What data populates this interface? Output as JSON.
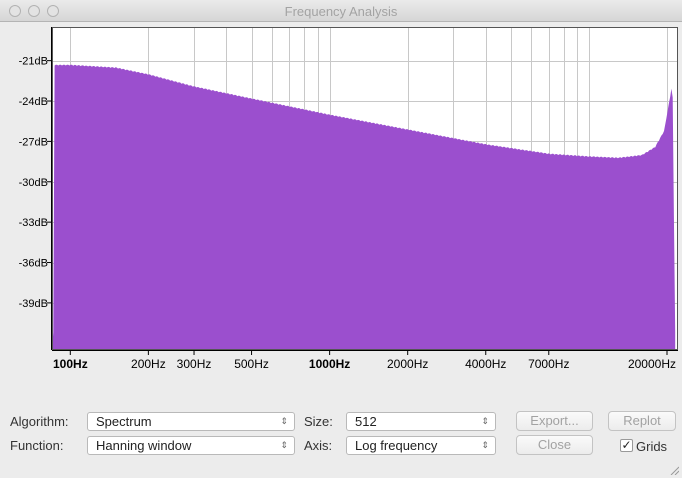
{
  "window": {
    "title": "Frequency Analysis"
  },
  "chart_data": {
    "type": "area",
    "title": "",
    "xlabel": "",
    "ylabel": "",
    "x_scale": "log",
    "xlim": [
      85,
      22050
    ],
    "ylim": [
      -42.5,
      -18.5
    ],
    "grid": true,
    "fill_color": "#9b4fce",
    "x_ticks": [
      {
        "value": 100,
        "label": "100Hz",
        "bold": true
      },
      {
        "value": 200,
        "label": "200Hz",
        "bold": false
      },
      {
        "value": 300,
        "label": "300Hz",
        "bold": false
      },
      {
        "value": 500,
        "label": "500Hz",
        "bold": false
      },
      {
        "value": 1000,
        "label": "1000Hz",
        "bold": true
      },
      {
        "value": 2000,
        "label": "2000Hz",
        "bold": false
      },
      {
        "value": 4000,
        "label": "4000Hz",
        "bold": false
      },
      {
        "value": 7000,
        "label": "7000Hz",
        "bold": false
      },
      {
        "value": 20000,
        "label": "20000Hz",
        "bold": false
      }
    ],
    "y_ticks": [
      {
        "value": -21,
        "label": "-21dB"
      },
      {
        "value": -24,
        "label": "-24dB"
      },
      {
        "value": -27,
        "label": "-27dB"
      },
      {
        "value": -30,
        "label": "-30dB"
      },
      {
        "value": -33,
        "label": "-33dB"
      },
      {
        "value": -36,
        "label": "-36dB"
      },
      {
        "value": -39,
        "label": "-39dB"
      }
    ],
    "x": [
      86,
      100,
      150,
      200,
      300,
      500,
      1000,
      2000,
      4000,
      7000,
      10000,
      13000,
      16000,
      18000,
      19500,
      20500,
      21000,
      21500
    ],
    "y": [
      -21.3,
      -21.3,
      -21.5,
      -22.0,
      -22.9,
      -23.8,
      -25.0,
      -26.1,
      -27.2,
      -27.9,
      -28.1,
      -28.2,
      -28.0,
      -27.4,
      -26.2,
      -23.8,
      -22.6,
      -41.2
    ]
  },
  "controls": {
    "algorithm_label": "Algorithm:",
    "algorithm_value": "Spectrum",
    "function_label": "Function:",
    "function_value": "Hanning window",
    "size_label": "Size:",
    "size_value": "512",
    "axis_label": "Axis:",
    "axis_value": "Log frequency",
    "export_label": "Export...",
    "replot_label": "Replot",
    "close_label": "Close",
    "grids_label": "Grids",
    "grids_checked": true
  }
}
